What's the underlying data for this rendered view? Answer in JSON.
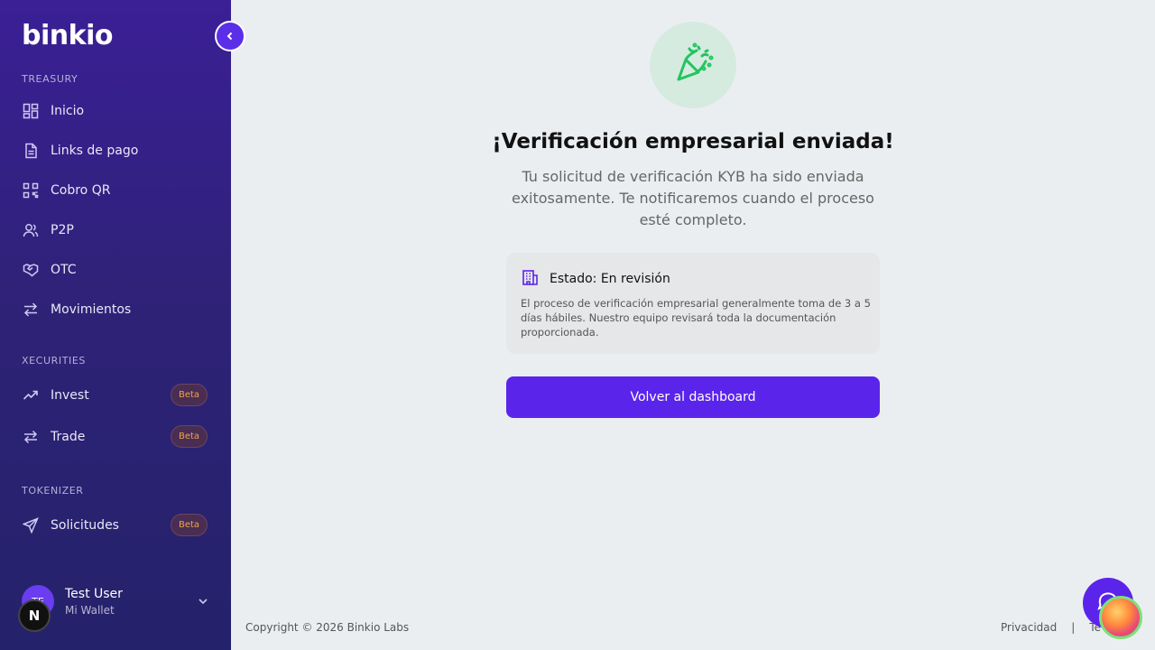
{
  "brand": {
    "logo": "binkio"
  },
  "sidebar": {
    "sections": [
      {
        "label": "TREASURY"
      },
      {
        "label": "XECURITIES"
      },
      {
        "label": "TOKENIZER"
      }
    ],
    "items": [
      {
        "label": "Inicio",
        "icon": "grid-icon"
      },
      {
        "label": "Links de pago",
        "icon": "document-icon"
      },
      {
        "label": "Cobro QR",
        "icon": "qr-code-icon"
      },
      {
        "label": "P2P",
        "icon": "users-icon"
      },
      {
        "label": "OTC",
        "icon": "handshake-icon"
      },
      {
        "label": "Movimientos",
        "icon": "arrows-swap-icon"
      },
      {
        "label": "Invest",
        "icon": "trending-up-icon",
        "badge": "Beta"
      },
      {
        "label": "Trade",
        "icon": "arrows-exchange-icon",
        "badge": "Beta"
      },
      {
        "label": "Solicitudes",
        "icon": "send-icon",
        "badge": "Beta"
      }
    ],
    "user": {
      "initials": "TE",
      "name": "Test User",
      "subtitle": "Mi Wallet"
    },
    "n_badge": "N"
  },
  "main": {
    "icon": "party-popper-icon",
    "title": "¡Verificación empresarial enviada!",
    "subtitle": "Tu solicitud de verificación KYB ha sido enviada exitosamente. Te notificaremos cuando el proceso esté completo.",
    "status": {
      "label": "Estado: En revisión",
      "icon": "building-icon",
      "description": "El proceso de verificación empresarial generalmente toma de 3 a 5 días hábiles. Nuestro equipo revisará toda la documentación proporcionada."
    },
    "cta": "Volver al dashboard"
  },
  "footer": {
    "copyright": "Copyright © 2026 Binkio Labs",
    "links": [
      "Privacidad",
      "|",
      "Te"
    ]
  },
  "colors": {
    "accent": "#5b24ea",
    "success": "#22c55e",
    "beta_text": "#f0a34a"
  }
}
